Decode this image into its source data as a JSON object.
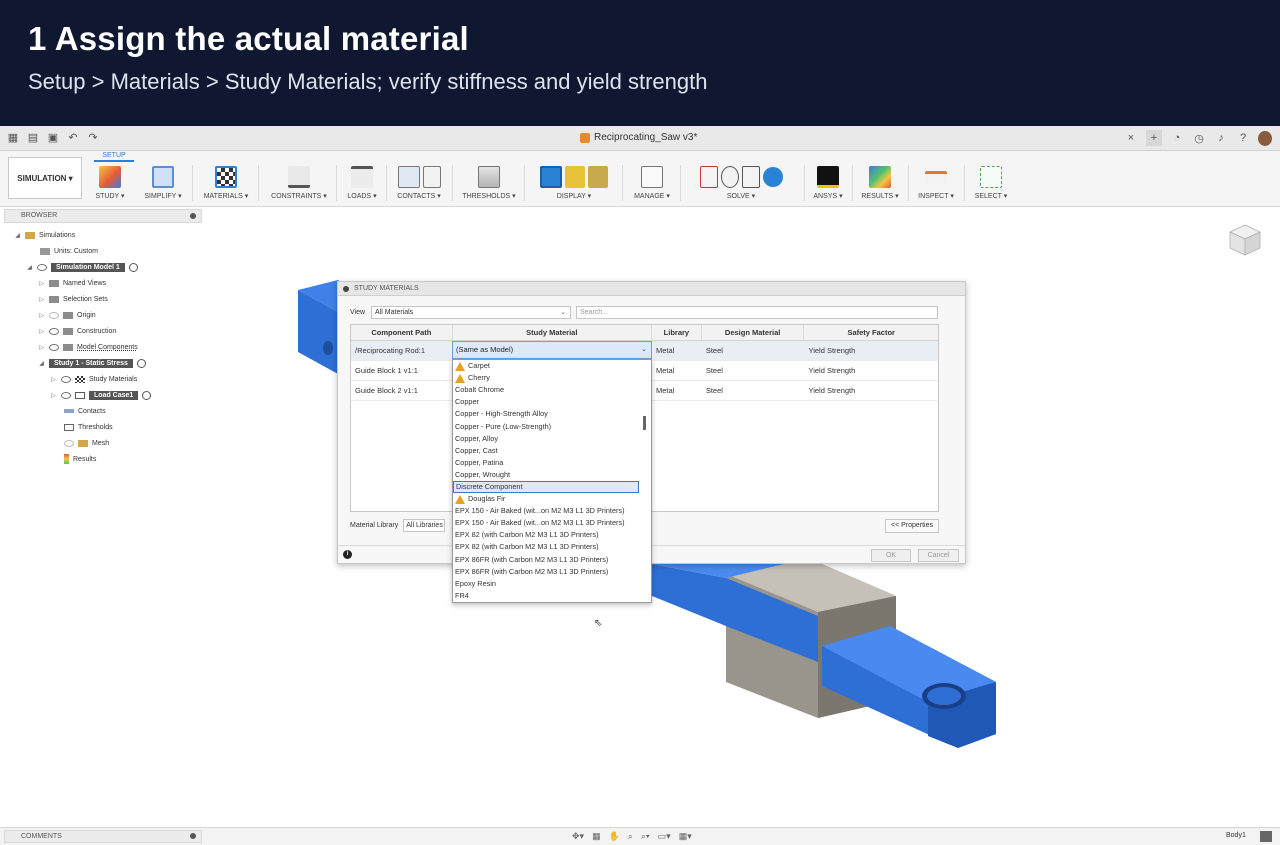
{
  "caption": {
    "title": "1  Assign the actual material",
    "subtitle": "Setup > Materials > Study Materials; verify stiffness and yield strength"
  },
  "window": {
    "doc_title": "Reciprocating_Saw v3*"
  },
  "toolbar": {
    "workspace": "SIMULATION ▾",
    "active_tab": "SETUP",
    "groups": [
      {
        "label": "STUDY ▾"
      },
      {
        "label": "SIMPLIFY ▾"
      },
      {
        "label": "MATERIALS ▾"
      },
      {
        "label": "CONSTRAINTS ▾"
      },
      {
        "label": "LOADS ▾"
      },
      {
        "label": "CONTACTS ▾"
      },
      {
        "label": "THRESHOLDS ▾"
      },
      {
        "label": "DISPLAY ▾"
      },
      {
        "label": "MANAGE ▾"
      },
      {
        "label": "SOLVE ▾"
      },
      {
        "label": "ANSYS ▾"
      },
      {
        "label": "RESULTS ▾"
      },
      {
        "label": "INSPECT ▾"
      },
      {
        "label": "SELECT ▾"
      }
    ]
  },
  "browser": {
    "title": "BROWSER",
    "nodes": [
      {
        "label": "Simulations"
      },
      {
        "label": "Units: Custom"
      },
      {
        "label": "Simulation Model 1"
      },
      {
        "label": "Named Views"
      },
      {
        "label": "Selection Sets"
      },
      {
        "label": "Origin"
      },
      {
        "label": "Construction"
      },
      {
        "label": "Model Components"
      },
      {
        "label": "Study 1 - Static Stress"
      },
      {
        "label": "Study Materials"
      },
      {
        "label": "Load Case1"
      },
      {
        "label": "Contacts"
      },
      {
        "label": "Thresholds"
      },
      {
        "label": "Mesh"
      },
      {
        "label": "Results"
      }
    ]
  },
  "dialog": {
    "title": "STUDY MATERIALS",
    "view_label": "View",
    "view_value": "All Materials",
    "search_placeholder": "Search...",
    "columns": [
      "Component Path",
      "Study Material",
      "Library",
      "Design Material",
      "Safety Factor"
    ],
    "rows": [
      {
        "path": "/Reciprocating Rod:1",
        "study_material": "(Same as Model)",
        "library": "Metal",
        "design_material": "Steel",
        "safety_factor": "Yield Strength"
      },
      {
        "path": "Guide Block 1 v1:1",
        "study_material": "",
        "library": "Metal",
        "design_material": "Steel",
        "safety_factor": "Yield Strength"
      },
      {
        "path": "Guide Block 2 v1:1",
        "study_material": "",
        "library": "Metal",
        "design_material": "Steel",
        "safety_factor": "Yield Strength"
      }
    ],
    "material_library_label": "Material Library",
    "material_library_value": "All Libraries",
    "properties_button": "<< Properties",
    "ok_button": "OK",
    "cancel_button": "Cancel"
  },
  "dropdown": {
    "selected": "(Same as Model)",
    "highlighted": "Discrete Component",
    "options": [
      {
        "label": "Carpet",
        "warn": true
      },
      {
        "label": "Cherry",
        "warn": true
      },
      {
        "label": "Cobalt Chrome",
        "warn": false
      },
      {
        "label": "Copper",
        "warn": false
      },
      {
        "label": "Copper - High-Strength Alloy",
        "warn": false
      },
      {
        "label": "Copper - Pure (Low-Strength)",
        "warn": false
      },
      {
        "label": "Copper, Alloy",
        "warn": false
      },
      {
        "label": "Copper, Cast",
        "warn": false
      },
      {
        "label": "Copper, Patina",
        "warn": false
      },
      {
        "label": "Copper, Wrought",
        "warn": false
      },
      {
        "label": "Discrete Component",
        "warn": false
      },
      {
        "label": "Douglas Fir",
        "warn": true
      },
      {
        "label": "EPX 150 - Air Baked (wit...on M2 M3 L1 3D Printers)",
        "warn": false
      },
      {
        "label": "EPX 150 - Air Baked (wit...on M2 M3 L1 3D Printers)",
        "warn": false
      },
      {
        "label": "EPX 82 (with Carbon M2 M3 L1 3D Printers)",
        "warn": false
      },
      {
        "label": "EPX 82 (with Carbon M2 M3 L1 3D Printers)",
        "warn": false
      },
      {
        "label": "EPX 86FR (with Carbon M2 M3 L1 3D Printers)",
        "warn": false
      },
      {
        "label": "EPX 86FR (with Carbon M2 M3 L1 3D Printers)",
        "warn": false
      },
      {
        "label": "Epoxy Resin",
        "warn": false
      },
      {
        "label": "FR4",
        "warn": false
      }
    ]
  },
  "statusbar": {
    "comments": "COMMENTS",
    "selection": "Body1"
  },
  "colors": {
    "banner_bg": "#0f1830",
    "model_blue": "#2e6fd6",
    "model_gray": "#9a958c",
    "accent": "#2a82d6"
  }
}
